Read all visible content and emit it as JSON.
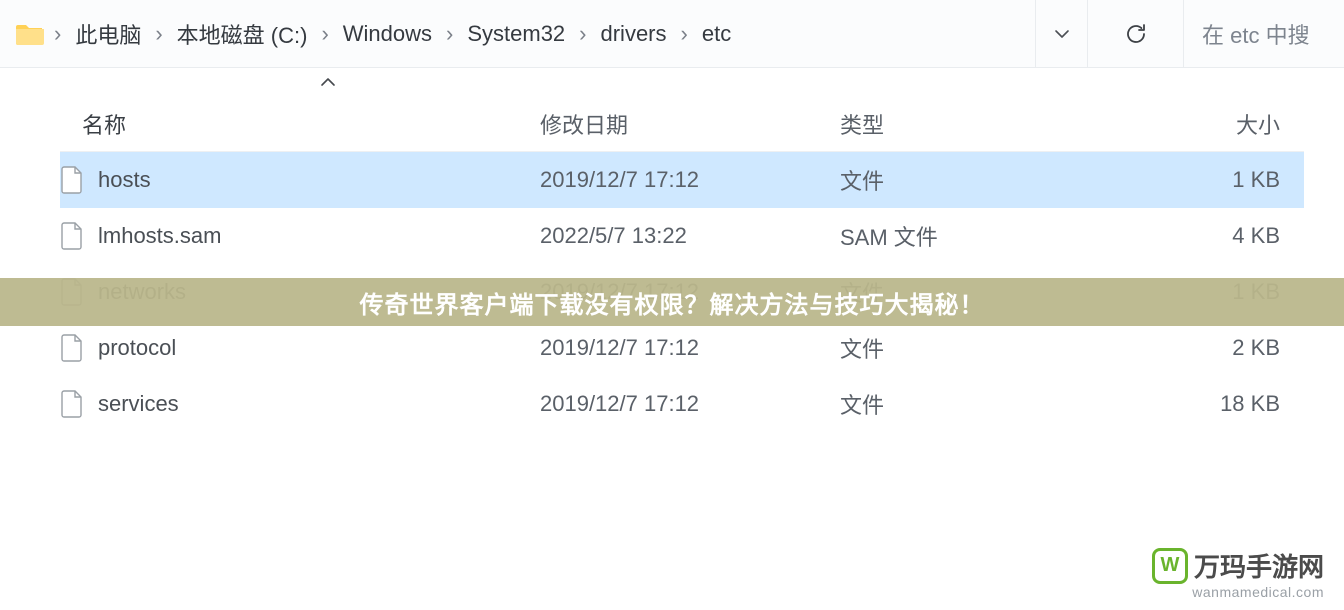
{
  "breadcrumb": {
    "items": [
      "此电脑",
      "本地磁盘 (C:)",
      "Windows",
      "System32",
      "drivers",
      "etc"
    ],
    "separator": "›"
  },
  "search": {
    "placeholder": "在 etc 中搜"
  },
  "columns": {
    "name": "名称",
    "date": "修改日期",
    "type": "类型",
    "size": "大小"
  },
  "files": [
    {
      "name": "hosts",
      "date": "2019/12/7 17:12",
      "type": "文件",
      "size": "1 KB",
      "selected": true
    },
    {
      "name": "lmhosts.sam",
      "date": "2022/5/7 13:22",
      "type": "SAM 文件",
      "size": "4 KB",
      "selected": false
    },
    {
      "name": "networks",
      "date": "2019/12/7 17:12",
      "type": "文件",
      "size": "1 KB",
      "selected": false,
      "faded": true
    },
    {
      "name": "protocol",
      "date": "2019/12/7 17:12",
      "type": "文件",
      "size": "2 KB",
      "selected": false
    },
    {
      "name": "services",
      "date": "2019/12/7 17:12",
      "type": "文件",
      "size": "18 KB",
      "selected": false
    }
  ],
  "banner": {
    "text": "传奇世界客户端下载没有权限？解决方法与技巧大揭秘！"
  },
  "watermark": {
    "brand": "万玛手游网",
    "logo_letter": "W",
    "url": "wanmamedical.com"
  }
}
